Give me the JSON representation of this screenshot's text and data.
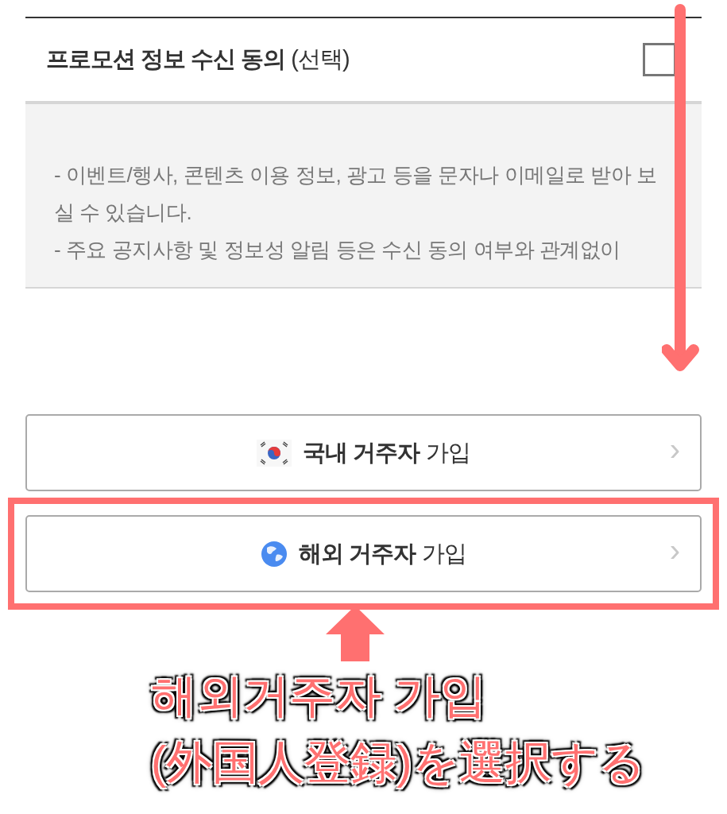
{
  "consent": {
    "title": "**프로모션 정보 수신 동의** (선택)",
    "checked": false,
    "lines": [
      "- 이벤트/행사, 콘텐츠 이용 정보, 광고 등을 문자나 이메일로 받아 보실 수 있습니다.",
      "- 주요 공지사항 및 정보성 알림 등은 수신 동의 여부와 관계없이"
    ]
  },
  "buttons": [
    {
      "kind": "domestic",
      "label": "**국내 거주자** 가입",
      "chevron": "›",
      "highlighted": false
    },
    {
      "kind": "overseas",
      "label": "**해외 거주자** 가입",
      "chevron": "›",
      "highlighted": true
    }
  ],
  "annotation": {
    "lines": [
      "해외거주자 가입",
      "(外国人登録)を選択する"
    ]
  }
}
